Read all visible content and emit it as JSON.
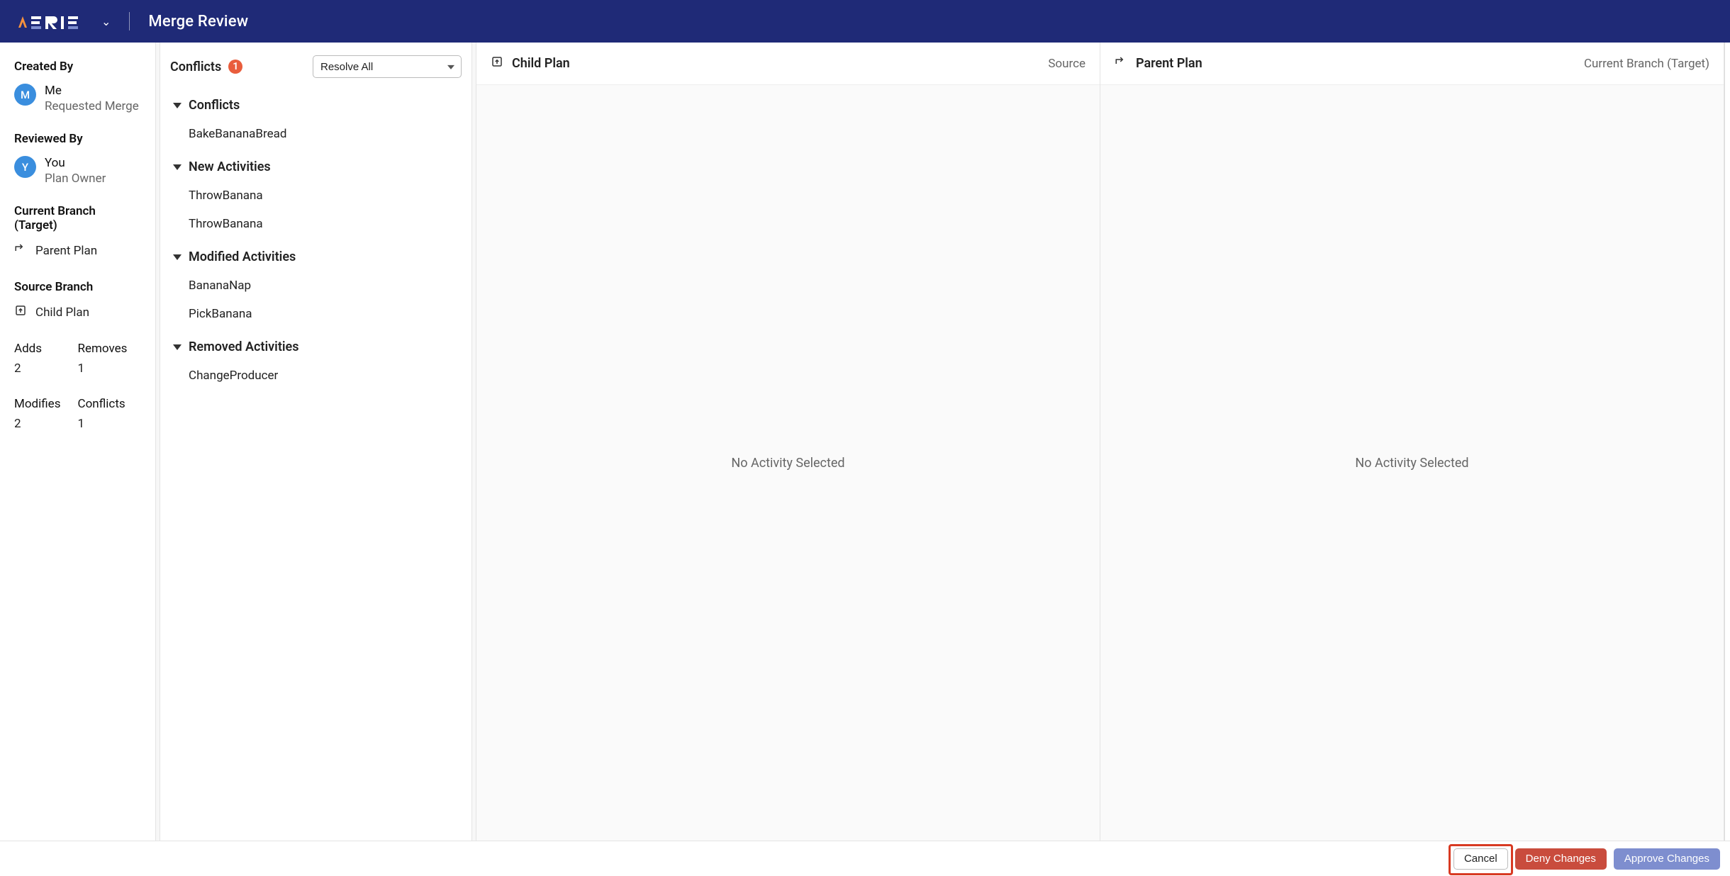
{
  "app": {
    "brand": "AERIE",
    "pageTitle": "Merge Review"
  },
  "sidebar": {
    "createdByLabel": "Created By",
    "createdBy": {
      "avatar": "M",
      "name": "Me",
      "sub": "Requested Merge"
    },
    "reviewedByLabel": "Reviewed By",
    "reviewedBy": {
      "avatar": "Y",
      "name": "You",
      "sub": "Plan Owner"
    },
    "currentBranchLabel": "Current Branch (Target)",
    "currentBranchName": "Parent Plan",
    "sourceBranchLabel": "Source Branch",
    "sourceBranchName": "Child Plan",
    "counts": {
      "addsLabel": "Adds",
      "adds": "2",
      "removesLabel": "Removes",
      "removes": "1",
      "modifiesLabel": "Modifies",
      "modifies": "2",
      "conflictsLabel": "Conflicts",
      "conflicts": "1"
    }
  },
  "conflicts": {
    "title": "Conflicts",
    "badge": "1",
    "resolveSelected": "Resolve All",
    "groups": [
      {
        "title": "Conflicts",
        "items": [
          "BakeBananaBread"
        ]
      },
      {
        "title": "New Activities",
        "items": [
          "ThrowBanana",
          "ThrowBanana"
        ]
      },
      {
        "title": "Modified Activities",
        "items": [
          "BananaNap",
          "PickBanana"
        ]
      },
      {
        "title": "Removed Activities",
        "items": [
          "ChangeProducer"
        ]
      }
    ]
  },
  "childPanel": {
    "title": "Child Plan",
    "tag": "Source",
    "empty": "No Activity Selected"
  },
  "parentPanel": {
    "title": "Parent Plan",
    "tag": "Current Branch (Target)",
    "empty": "No Activity Selected"
  },
  "footer": {
    "cancel": "Cancel",
    "deny": "Deny Changes",
    "approve": "Approve Changes"
  }
}
